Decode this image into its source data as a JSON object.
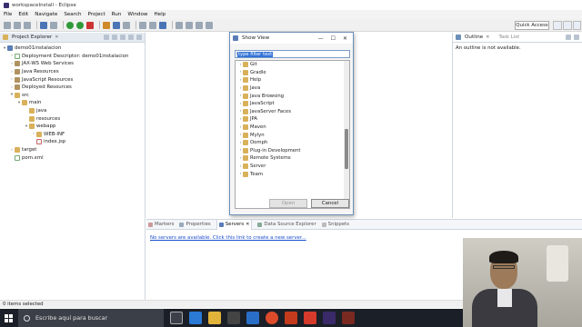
{
  "window": {
    "title": "workspaceInstall - Eclipse"
  },
  "menu": [
    "File",
    "Edit",
    "Navigate",
    "Search",
    "Project",
    "Run",
    "Window",
    "Help"
  ],
  "toolbar": {
    "quick_access": "Quick Access"
  },
  "project_explorer": {
    "tab_label": "Project Explorer",
    "tree": [
      {
        "label": "demo01instalacion",
        "level": 0,
        "arrow": "▾",
        "icon": "proj"
      },
      {
        "label": "Deployment Descriptor: demo01instalacion",
        "level": 1,
        "arrow": "›",
        "icon": "xml"
      },
      {
        "label": "JAX-WS Web Services",
        "level": 1,
        "arrow": "›",
        "icon": "lib"
      },
      {
        "label": "Java Resources",
        "level": 1,
        "arrow": "›",
        "icon": "lib"
      },
      {
        "label": "JavaScript Resources",
        "level": 1,
        "arrow": "›",
        "icon": "lib"
      },
      {
        "label": "Deployed Resources",
        "level": 1,
        "arrow": "›",
        "icon": "lib"
      },
      {
        "label": "src",
        "level": 1,
        "arrow": "▾",
        "icon": "folder"
      },
      {
        "label": "main",
        "level": 2,
        "arrow": "▾",
        "icon": "folder"
      },
      {
        "label": "java",
        "level": 3,
        "arrow": "",
        "icon": "folder"
      },
      {
        "label": "resources",
        "level": 3,
        "arrow": "",
        "icon": "folder"
      },
      {
        "label": "webapp",
        "level": 3,
        "arrow": "▾",
        "icon": "folder"
      },
      {
        "label": "WEB-INF",
        "level": 4,
        "arrow": "›",
        "icon": "folder"
      },
      {
        "label": "index.jsp",
        "level": 4,
        "arrow": "",
        "icon": "jsp"
      },
      {
        "label": "target",
        "level": 1,
        "arrow": "›",
        "icon": "folder"
      },
      {
        "label": "pom.xml",
        "level": 1,
        "arrow": "",
        "icon": "xml"
      }
    ]
  },
  "outline": {
    "tab_label": "Outline",
    "task_tab": "Task List",
    "message": "An outline is not available."
  },
  "bottom_panel": {
    "tabs": [
      "Markers",
      "Properties",
      "Servers",
      "Data Source Explorer",
      "Snippets"
    ],
    "active_tab": "Servers",
    "link_text": "No servers are available. Click this link to create a new server..."
  },
  "status_bar": {
    "text": "0 items selected"
  },
  "dialog": {
    "title": "Show View",
    "filter_placeholder": "type filter text",
    "items": [
      "Git",
      "Gradle",
      "Help",
      "Java",
      "Java Browsing",
      "JavaScript",
      "JavaServer Faces",
      "JPA",
      "Maven",
      "Mylyn",
      "Oomph",
      "Plug-in Development",
      "Remote Systems",
      "Server",
      "Team"
    ],
    "ok_label": "Open",
    "cancel_label": "Cancel",
    "minimize": "—",
    "maximize": "☐",
    "close": "✕"
  },
  "taskbar": {
    "search_placeholder": "Escribe aquí para buscar"
  },
  "colors": {
    "accent": "#3373d8",
    "taskbar": "#1b1f27",
    "link": "#1a4dcc"
  }
}
